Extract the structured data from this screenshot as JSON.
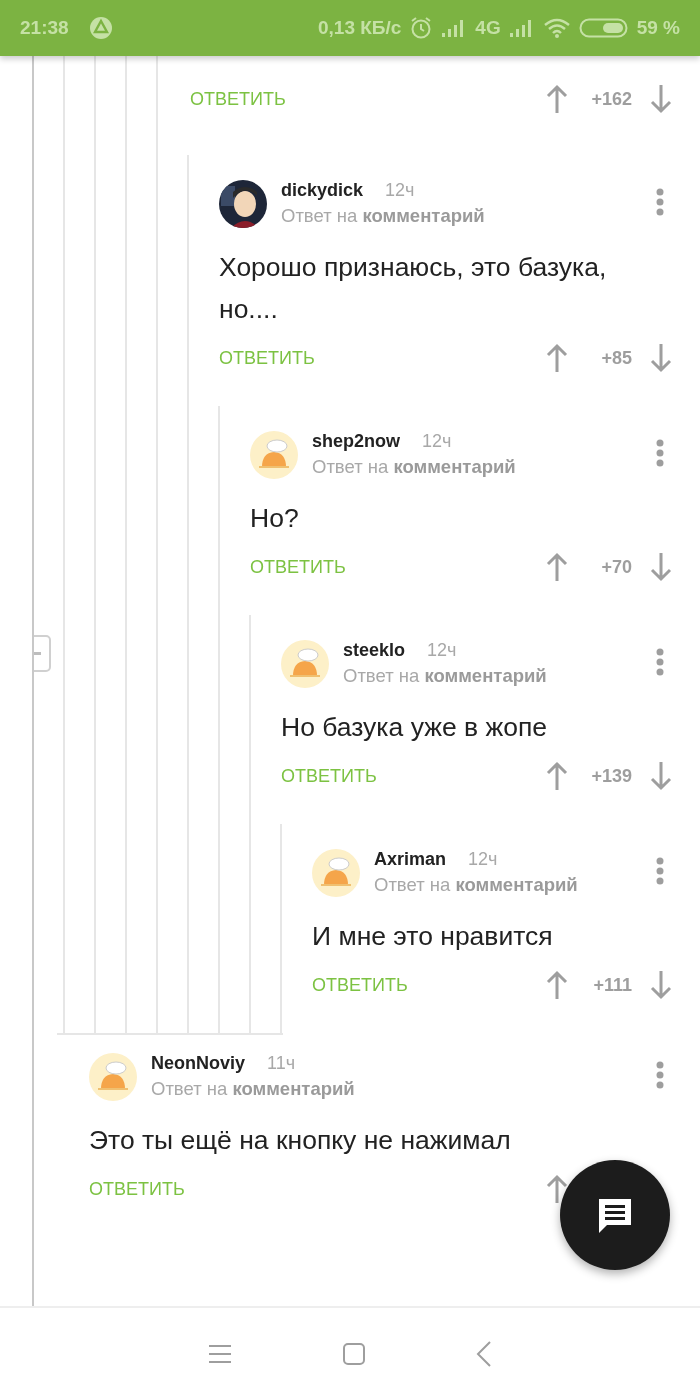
{
  "status_bar": {
    "time": "21:38",
    "speed": "0,13 КБ/с",
    "network": "4G",
    "battery": "59 %"
  },
  "comments": [
    {
      "kind": "tail",
      "reply_label": "ОТВЕТИТЬ",
      "score": "+162",
      "children": [
        {
          "kind": "comment",
          "author": "dickydick",
          "time": "12ч",
          "avatar": {
            "kind": "photo"
          },
          "reply_prefix": "Ответ на",
          "reply_target": "комментарий",
          "text": "Хорошо признаюсь, это базука, но....",
          "reply_label": "ОТВЕТИТЬ",
          "score": "+85",
          "children": [
            {
              "kind": "comment",
              "author": "shep2now",
              "time": "12ч",
              "avatar": {
                "kind": "default"
              },
              "reply_prefix": "Ответ на",
              "reply_target": "комментарий",
              "text": "Но?",
              "reply_label": "ОТВЕТИТЬ",
              "score": "+70",
              "children": [
                {
                  "kind": "comment",
                  "author": "steeklo",
                  "time": "12ч",
                  "avatar": {
                    "kind": "default"
                  },
                  "reply_prefix": "Ответ на",
                  "reply_target": "комментарий",
                  "text": "Но базука уже в жопе",
                  "reply_label": "ОТВЕТИТЬ",
                  "score": "+139",
                  "children": [
                    {
                      "kind": "comment",
                      "author": "Axriman",
                      "time": "12ч",
                      "avatar": {
                        "kind": "default"
                      },
                      "reply_prefix": "Ответ на",
                      "reply_target": "комментарий",
                      "text": "И мне это нравится",
                      "reply_label": "ОТВЕТИТЬ",
                      "score": "+111"
                    }
                  ]
                }
              ]
            }
          ]
        }
      ]
    },
    {
      "kind": "comment",
      "author": "NeonNoviy",
      "time": "11ч",
      "avatar": {
        "kind": "default"
      },
      "reply_prefix": "Ответ на",
      "reply_target": "комментарий",
      "text": "Это ты ещё на кнопку не нажимал",
      "reply_label": "ОТВЕТИТЬ"
    }
  ]
}
